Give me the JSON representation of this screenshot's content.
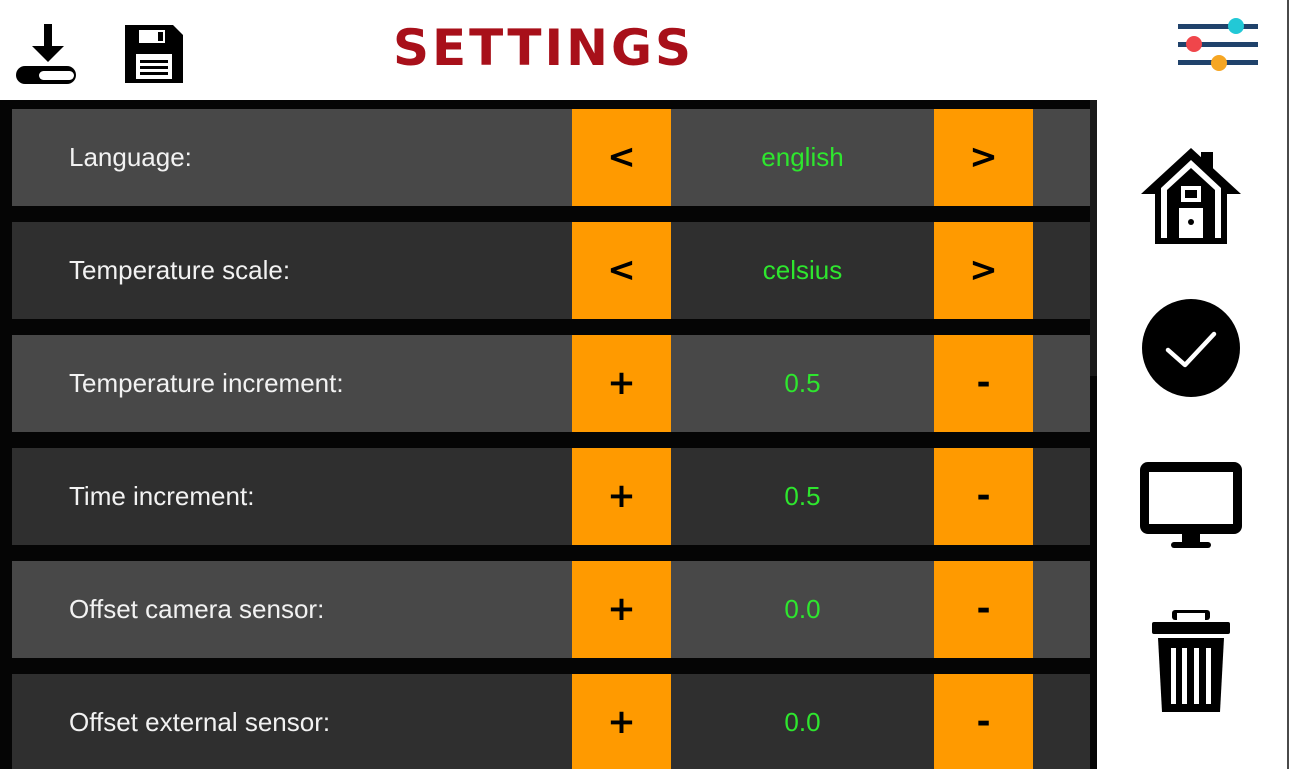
{
  "header": {
    "title": "SETTINGS",
    "title_color": "#a8101a",
    "left_icons": [
      "download-icon",
      "save-icon"
    ],
    "right_icon": "sliders-icon"
  },
  "settings": [
    {
      "label": "Language:",
      "value": "english",
      "left_btn": "<",
      "right_btn": ">",
      "row_color": "#484848"
    },
    {
      "label": "Temperature scale:",
      "value": "celsius",
      "left_btn": "<",
      "right_btn": ">",
      "row_color": "#2f2f2f"
    },
    {
      "label": "Temperature increment:",
      "value": "0.5",
      "left_btn": "+",
      "right_btn": "-",
      "row_color": "#484848"
    },
    {
      "label": "Time increment:",
      "value": "0.5",
      "left_btn": "+",
      "right_btn": "-",
      "row_color": "#2f2f2f"
    },
    {
      "label": "Offset camera sensor:",
      "value": "0.0",
      "left_btn": "+",
      "right_btn": "-",
      "row_color": "#484848"
    },
    {
      "label": "Offset external sensor:",
      "value": "0.0",
      "left_btn": "+",
      "right_btn": "-",
      "row_color": "#2f2f2f"
    }
  ],
  "colors": {
    "accent": "#ff9a00",
    "value_text": "#2ee62e",
    "list_bg": "#050505"
  },
  "side_nav": [
    "home-icon",
    "confirm-check-icon",
    "monitor-icon",
    "trash-icon"
  ]
}
